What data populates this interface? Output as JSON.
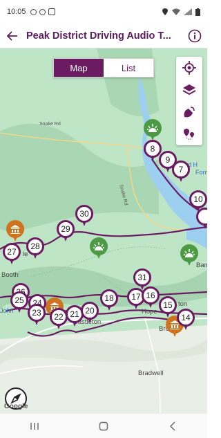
{
  "status_bar": {
    "time": "10:05"
  },
  "app_bar": {
    "title": "Peak District Driving Audio T..."
  },
  "view_toggle": {
    "map_label": "Map",
    "list_label": "List"
  },
  "map": {
    "labels": {
      "snake_rd": "Snake Rd",
      "snake_rd_vertical": "Snake Rd",
      "booth": "Booth",
      "castleton": "Castleton",
      "hope": "Hope",
      "brough": "Brough",
      "bradwell": "Bradwell",
      "bam": "Bam",
      "and_h": "and H",
      "form": "Form",
      "ton": "ton",
      "le": "le",
      "john": "John"
    },
    "pins": [
      "8",
      "9",
      "7",
      "10",
      "30",
      "29",
      "28",
      "27",
      "26",
      "25",
      "24",
      "23",
      "22",
      "21",
      "20",
      "18",
      "17",
      "16",
      "31",
      "15",
      "14"
    ],
    "attribution": "Google"
  },
  "colors": {
    "accent": "#6a1b62",
    "map_green": "#bfe5c7",
    "water": "#9ccff0",
    "poi_green": "#4c9a43",
    "poi_orange": "#d0731f"
  }
}
